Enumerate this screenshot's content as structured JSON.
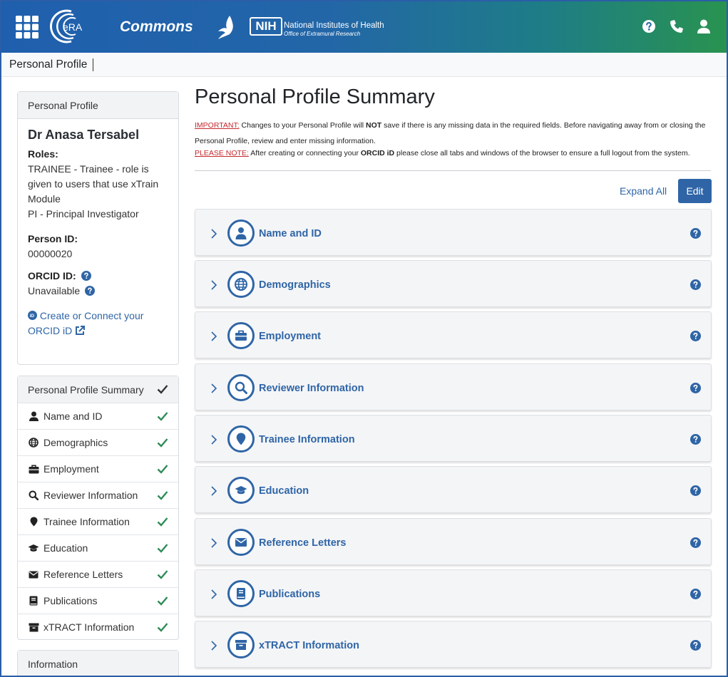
{
  "header": {
    "app_name": "Commons",
    "logo_text": "eRA",
    "nih_badge": "NIH",
    "nih_name": "National Institutes of Health",
    "nih_office": "Office of Extramural Research",
    "icons": [
      "grid-icon",
      "help-icon",
      "phone-icon",
      "user-icon"
    ]
  },
  "breadcrumb": {
    "current": "Personal Profile"
  },
  "profile_card": {
    "heading": "Personal Profile",
    "name": "Dr Anasa Tersabel",
    "roles_label": "Roles:",
    "roles": [
      "TRAINEE - Trainee - role is given to users that use xTrain Module",
      "PI - Principal Investigator"
    ],
    "person_id_label": "Person ID:",
    "person_id": "00000020",
    "orcid_label": "ORCID ID:",
    "orcid_value": "Unavailable",
    "orcid_link": "Create or Connect your ORCID iD"
  },
  "nav": {
    "items": [
      {
        "label": "Personal Profile Summary",
        "icon": "none"
      },
      {
        "label": "Name and ID",
        "icon": "user-icon"
      },
      {
        "label": "Demographics",
        "icon": "globe-icon"
      },
      {
        "label": "Employment",
        "icon": "briefcase-icon"
      },
      {
        "label": "Reviewer Information",
        "icon": "search-icon"
      },
      {
        "label": "Trainee Information",
        "icon": "map-pin-icon"
      },
      {
        "label": "Education",
        "icon": "graduation-cap-icon"
      },
      {
        "label": "Reference Letters",
        "icon": "envelope-icon"
      },
      {
        "label": "Publications",
        "icon": "book-icon"
      },
      {
        "label": "xTRACT Information",
        "icon": "archive-icon"
      }
    ]
  },
  "info_card": {
    "heading": "Information"
  },
  "main": {
    "title": "Personal Profile Summary",
    "important_tag": "IMPORTANT:",
    "important_text_1": " Changes to your Personal Profile will ",
    "important_bold": "NOT",
    "important_text_2": " save if there is any missing data in the required fields. Before navigating away from or closing the Personal Profile, review and enter missing information.",
    "note_tag": "PLEASE NOTE:",
    "note_text_1": " After creating or connecting your ",
    "note_bold": "ORCID iD",
    "note_text_2": " please close all tabs and windows of the browser to ensure a full logout from the system.",
    "expand_all": "Expand All",
    "edit": "Edit",
    "sections": [
      {
        "label": "Name and ID",
        "icon": "user-icon"
      },
      {
        "label": "Demographics",
        "icon": "globe-icon"
      },
      {
        "label": "Employment",
        "icon": "briefcase-icon"
      },
      {
        "label": "Reviewer Information",
        "icon": "search-icon"
      },
      {
        "label": "Trainee Information",
        "icon": "map-pin-icon"
      },
      {
        "label": "Education",
        "icon": "graduation-cap-icon"
      },
      {
        "label": "Reference Letters",
        "icon": "envelope-icon"
      },
      {
        "label": "Publications",
        "icon": "book-icon"
      },
      {
        "label": "xTRACT Information",
        "icon": "archive-icon"
      }
    ]
  },
  "colors": {
    "primary": "#2f65a6",
    "check": "#2e8b57",
    "alert": "#c4282d",
    "header_start": "#1f5fad",
    "header_end": "#29934f"
  }
}
